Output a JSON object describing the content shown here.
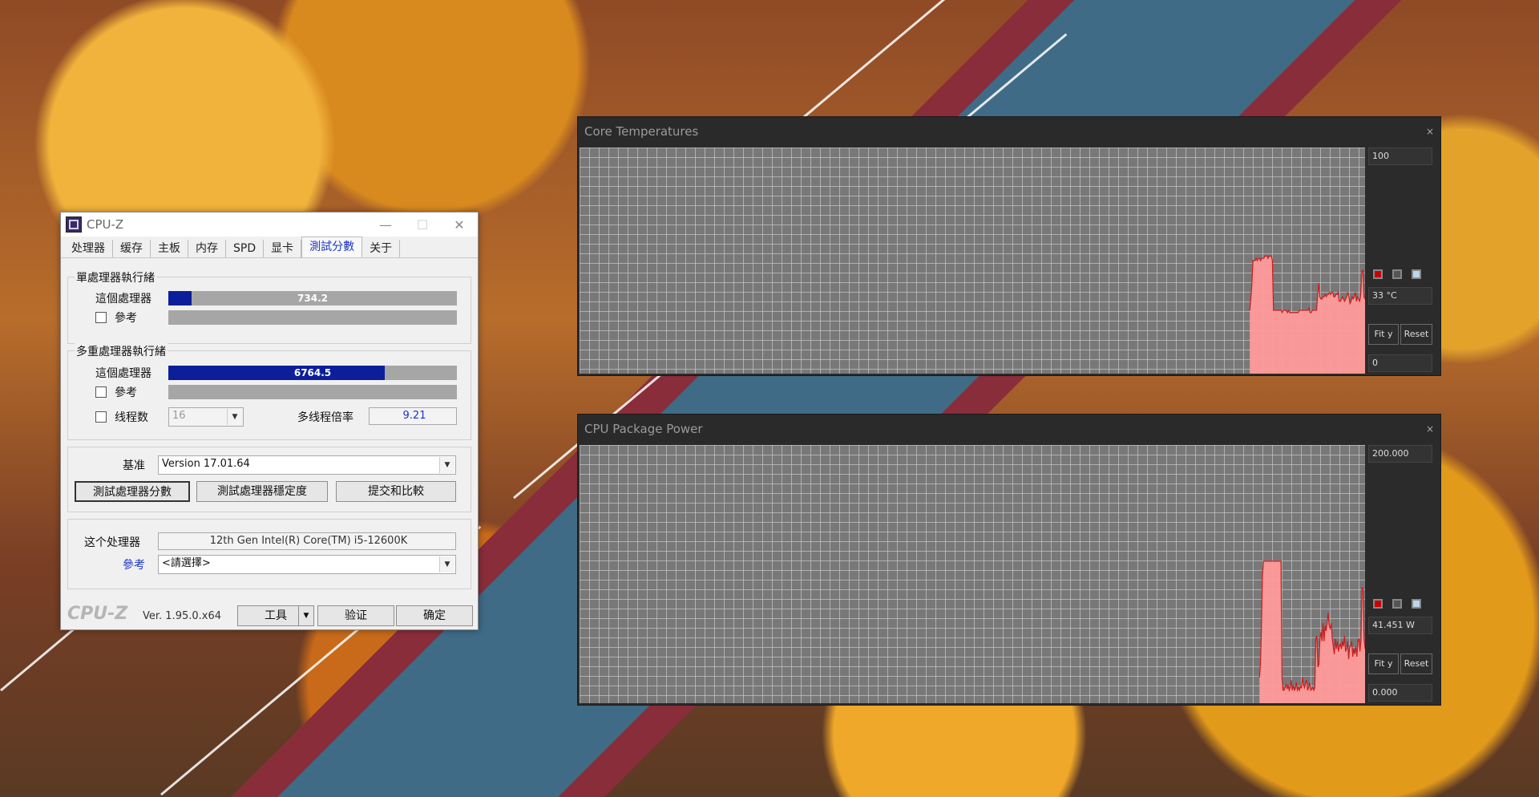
{
  "cpuz": {
    "title": "CPU-Z",
    "tabs": [
      "处理器",
      "缓存",
      "主板",
      "内存",
      "SPD",
      "显卡",
      "測試分數",
      "关于"
    ],
    "active_tab": "測試分數",
    "single": {
      "group_label": "單處理器執行緒",
      "this_label": "這個處理器",
      "this_score": "734.2",
      "this_fraction": 0.08,
      "ref_label": "參考"
    },
    "multi": {
      "group_label": "多重處理器執行緒",
      "this_label": "這個處理器",
      "this_score": "6764.5",
      "this_fraction": 0.75,
      "ref_label": "參考",
      "threads_label": "线程数",
      "threads_value": "16",
      "ratio_label": "多线程倍率",
      "ratio_value": "9.21"
    },
    "bench": {
      "label": "基准",
      "version": "Version 17.01.64",
      "btn_score": "測試處理器分數",
      "btn_stress": "測試處理器穩定度",
      "btn_submit": "提交和比較"
    },
    "proc": {
      "label": "这个处理器",
      "value": "12th Gen Intel(R) Core(TM) i5-12600K",
      "ref_label": "參考",
      "ref_select": "<請選擇>"
    },
    "footer": {
      "logo": "CPU-Z",
      "version": "Ver. 1.95.0.x64",
      "tools": "工具",
      "validate": "验证",
      "ok": "确定"
    }
  },
  "temp_monitor": {
    "title": "Core Temperatures",
    "close": "×",
    "max": "100",
    "current": "33 °C",
    "min": "0",
    "fit": "Fit y",
    "reset": "Reset",
    "colors": {
      "line": "#c81e1e",
      "fill": "#ff9a9a"
    },
    "chart_data": {
      "type": "area",
      "ylim": [
        0,
        100
      ],
      "values": [
        0,
        0,
        0,
        0,
        0,
        0,
        0,
        0,
        0,
        0,
        0,
        0,
        0,
        0,
        0,
        0,
        0,
        0,
        0,
        0,
        0,
        0,
        0,
        0,
        0,
        0,
        0,
        0,
        0,
        0,
        0,
        0,
        0,
        0,
        0,
        0,
        0,
        0,
        0,
        0,
        0,
        0,
        0,
        0,
        0,
        0,
        0,
        0,
        0,
        0,
        0,
        0,
        0,
        0,
        0,
        0,
        0,
        0,
        0,
        0,
        0,
        0,
        0,
        0,
        0,
        0,
        0,
        0,
        0,
        0,
        0,
        0,
        0,
        0,
        0,
        0,
        0,
        0,
        0,
        0,
        0,
        0,
        0,
        0,
        0,
        0,
        0,
        0,
        0,
        0,
        0,
        0,
        0,
        0,
        0,
        0,
        0,
        0,
        0,
        0,
        0,
        0,
        0,
        0,
        0,
        0,
        0,
        0,
        0,
        0,
        0,
        0,
        0,
        0,
        0,
        0,
        0,
        0,
        0,
        0,
        0,
        0,
        0,
        0,
        0,
        0,
        0,
        0,
        0,
        0,
        0,
        0,
        0,
        0,
        0,
        0,
        0,
        0,
        0,
        0,
        0,
        0,
        0,
        0,
        0,
        0,
        0,
        0,
        0,
        0,
        0,
        0,
        0,
        0,
        0,
        0,
        0,
        0,
        0,
        0,
        0,
        0,
        0,
        0,
        0,
        0,
        0,
        0,
        0,
        0,
        0,
        0,
        0,
        0,
        0,
        0,
        0,
        0,
        0,
        0,
        0,
        0,
        0,
        0,
        0,
        0,
        0,
        0,
        0,
        0,
        0,
        0,
        0,
        0,
        0,
        0,
        0,
        0,
        0,
        0,
        0,
        0,
        0,
        0,
        0,
        0,
        0,
        0,
        0,
        0,
        0,
        0,
        0,
        0,
        0,
        0,
        0,
        0,
        0,
        0,
        0,
        0,
        0,
        0,
        0,
        0,
        0,
        0,
        0,
        0,
        0,
        0,
        0,
        0,
        0,
        0,
        0,
        0,
        0,
        0,
        0,
        0,
        0,
        0,
        0,
        0,
        0,
        0,
        0,
        0,
        0,
        0,
        0,
        0,
        0,
        0,
        0,
        0,
        0,
        0,
        0,
        0,
        0,
        0,
        0,
        0,
        0,
        0,
        0,
        0,
        0,
        0,
        0,
        0,
        0,
        0,
        0,
        0,
        0,
        0,
        0,
        0,
        0,
        0,
        0,
        0,
        0,
        0,
        0,
        0,
        0,
        0,
        0,
        0,
        0,
        0,
        0,
        0,
        0,
        0,
        0,
        0,
        0,
        0,
        0,
        0,
        0,
        0,
        0,
        0,
        0,
        0,
        0,
        0,
        0,
        0,
        0,
        0,
        0,
        0,
        0,
        0,
        0,
        0,
        0,
        0,
        0,
        0,
        0,
        0,
        0,
        0,
        0,
        0,
        0,
        0,
        0,
        0,
        0,
        0,
        0,
        0,
        0,
        0,
        0,
        0,
        0,
        0,
        0,
        0,
        0,
        0,
        0,
        0,
        0,
        0,
        0,
        0,
        0,
        0,
        0,
        0,
        0,
        0,
        0,
        0,
        0,
        0,
        0,
        0,
        0,
        0,
        0,
        0,
        0,
        0,
        0,
        0,
        0,
        0,
        0,
        0,
        0,
        0,
        0,
        0,
        0,
        0,
        0,
        0,
        0,
        0,
        0,
        0,
        0,
        0,
        0,
        0,
        0,
        0,
        0,
        0,
        0,
        0,
        0,
        0,
        0,
        0,
        0,
        0,
        0,
        0,
        0,
        0,
        0,
        0,
        0,
        0,
        0,
        0,
        0,
        0,
        0,
        0,
        0,
        0,
        0,
        0,
        0,
        0,
        0,
        0,
        0,
        0,
        0,
        0,
        0,
        0,
        0,
        0,
        0,
        0,
        0,
        0,
        0,
        0,
        0,
        0,
        0,
        0,
        0,
        0,
        0,
        0,
        0,
        0,
        0,
        0,
        0,
        0,
        0,
        0,
        0,
        0,
        0,
        0,
        0,
        0,
        0,
        0,
        0,
        0,
        0,
        0,
        0,
        0,
        0,
        0,
        0,
        0,
        0,
        0,
        0,
        0,
        0,
        0,
        0,
        0,
        0,
        0,
        0,
        0,
        0,
        0,
        0,
        0,
        0,
        0,
        0,
        0,
        0,
        0,
        0,
        0,
        0,
        0,
        0,
        0,
        0,
        0,
        0,
        0,
        0,
        0,
        0,
        0,
        0,
        0,
        0,
        0,
        0,
        0,
        0,
        0,
        0,
        0,
        0,
        0,
        0,
        0,
        0,
        0,
        0,
        0,
        0,
        0,
        0,
        0,
        0,
        0,
        0,
        0,
        0,
        0,
        0,
        0,
        0,
        0,
        0,
        0,
        0,
        0,
        0,
        0,
        0,
        0,
        0,
        0,
        0,
        0,
        0,
        0,
        0,
        0,
        0,
        0,
        0,
        0,
        0,
        0,
        0,
        0,
        0,
        0,
        0,
        0,
        0,
        0,
        0,
        0,
        0,
        0,
        0,
        0,
        0,
        0,
        0,
        0,
        0,
        0,
        0,
        0,
        0,
        0,
        0,
        0,
        0,
        0,
        0,
        0,
        0,
        0,
        0,
        0,
        0,
        0,
        0,
        0,
        0,
        0,
        0,
        0,
        0,
        0,
        0,
        0,
        0,
        0,
        0,
        0,
        0,
        0,
        28,
        33,
        40,
        50,
        50,
        50,
        51,
        50,
        51,
        51,
        50,
        51,
        51,
        51,
        52,
        52,
        52,
        51,
        52,
        52,
        52,
        50,
        28,
        28,
        28,
        28,
        28,
        28,
        28,
        28,
        27,
        28,
        28,
        28,
        28,
        27,
        28,
        27,
        27,
        27,
        27,
        27,
        27,
        27,
        27,
        27,
        28,
        28,
        28,
        28,
        28,
        28,
        28,
        28,
        28,
        29,
        27,
        27,
        28,
        28,
        28,
        28,
        28,
        35,
        40,
        34,
        33,
        33,
        34,
        34,
        35,
        34,
        35,
        35,
        36,
        35,
        36,
        36,
        34,
        34,
        35,
        35,
        36,
        32,
        32,
        33,
        34,
        33,
        32,
        33,
        34,
        36,
        34,
        31,
        32,
        34,
        33,
        34,
        36,
        32,
        34,
        33,
        32,
        35,
        45,
        46,
        34,
        33
      ]
    }
  },
  "power_monitor": {
    "title": "CPU Package Power",
    "close": "×",
    "max": "200.000",
    "current": "41.451 W",
    "min": "0.000",
    "fit": "Fit y",
    "reset": "Reset",
    "colors": {
      "line": "#c81e1e",
      "fill": "#ff9a9a"
    },
    "chart_data": {
      "type": "area",
      "ylim": [
        0,
        200
      ],
      "values": [
        0,
        0,
        0,
        0,
        0,
        0,
        0,
        0,
        0,
        0,
        0,
        0,
        0,
        0,
        0,
        0,
        0,
        0,
        0,
        0,
        0,
        0,
        0,
        0,
        0,
        0,
        0,
        0,
        0,
        0,
        0,
        0,
        0,
        0,
        0,
        0,
        0,
        0,
        0,
        0,
        0,
        0,
        0,
        0,
        0,
        0,
        0,
        0,
        0,
        0,
        0,
        0,
        0,
        0,
        0,
        0,
        0,
        0,
        0,
        0,
        0,
        0,
        0,
        0,
        0,
        0,
        0,
        0,
        0,
        0,
        0,
        0,
        0,
        0,
        0,
        0,
        0,
        0,
        0,
        0,
        0,
        0,
        0,
        0,
        0,
        0,
        0,
        0,
        0,
        0,
        0,
        0,
        0,
        0,
        0,
        0,
        0,
        0,
        0,
        0,
        0,
        0,
        0,
        0,
        0,
        0,
        0,
        0,
        0,
        0,
        0,
        0,
        0,
        0,
        0,
        0,
        0,
        0,
        0,
        0,
        0,
        0,
        0,
        0,
        0,
        0,
        0,
        0,
        0,
        0,
        0,
        0,
        0,
        0,
        0,
        0,
        0,
        0,
        0,
        0,
        0,
        0,
        0,
        0,
        0,
        0,
        0,
        0,
        0,
        0,
        0,
        0,
        0,
        0,
        0,
        0,
        0,
        0,
        0,
        0,
        0,
        0,
        0,
        0,
        0,
        0,
        0,
        0,
        0,
        0,
        0,
        0,
        0,
        0,
        0,
        0,
        0,
        0,
        0,
        0,
        0,
        0,
        0,
        0,
        0,
        0,
        0,
        0,
        0,
        0,
        0,
        0,
        0,
        0,
        0,
        0,
        0,
        0,
        0,
        0,
        0,
        0,
        0,
        0,
        0,
        0,
        0,
        0,
        0,
        0,
        0,
        0,
        0,
        0,
        0,
        0,
        0,
        0,
        0,
        0,
        0,
        0,
        0,
        0,
        0,
        0,
        0,
        0,
        0,
        0,
        0,
        0,
        0,
        0,
        0,
        0,
        0,
        0,
        0,
        0,
        0,
        0,
        0,
        0,
        0,
        0,
        0,
        0,
        0,
        0,
        0,
        0,
        0,
        0,
        0,
        0,
        0,
        0,
        0,
        0,
        0,
        0,
        0,
        0,
        0,
        0,
        0,
        0,
        0,
        0,
        0,
        0,
        0,
        0,
        0,
        0,
        0,
        0,
        0,
        0,
        0,
        0,
        0,
        0,
        0,
        0,
        0,
        0,
        0,
        0,
        0,
        0,
        0,
        0,
        0,
        0,
        0,
        0,
        0,
        0,
        0,
        0,
        0,
        0,
        0,
        0,
        0,
        0,
        0,
        0,
        0,
        0,
        0,
        0,
        0,
        0,
        0,
        0,
        0,
        0,
        0,
        0,
        0,
        0,
        0,
        0,
        0,
        0,
        0,
        0,
        0,
        0,
        0,
        0,
        0,
        0,
        0,
        0,
        0,
        0,
        0,
        0,
        0,
        0,
        0,
        0,
        0,
        0,
        0,
        0,
        0,
        0,
        0,
        0,
        0,
        0,
        0,
        0,
        0,
        0,
        0,
        0,
        0,
        0,
        0,
        0,
        0,
        0,
        0,
        0,
        0,
        0,
        0,
        0,
        0,
        0,
        0,
        0,
        0,
        0,
        0,
        0,
        0,
        0,
        0,
        0,
        0,
        0,
        0,
        0,
        0,
        0,
        0,
        0,
        0,
        0,
        0,
        0,
        0,
        0,
        0,
        0,
        0,
        0,
        0,
        0,
        0,
        0,
        0,
        0,
        0,
        0,
        0,
        0,
        0,
        0,
        0,
        0,
        0,
        0,
        0,
        0,
        0,
        0,
        0,
        0,
        0,
        0,
        0,
        0,
        0,
        0,
        0,
        0,
        0,
        0,
        0,
        0,
        0,
        0,
        0,
        0,
        0,
        0,
        0,
        0,
        0,
        0,
        0,
        0,
        0,
        0,
        0,
        0,
        0,
        0,
        0,
        0,
        0,
        0,
        0,
        0,
        0,
        0,
        0,
        0,
        0,
        0,
        0,
        0,
        0,
        0,
        0,
        0,
        0,
        0,
        0,
        0,
        0,
        0,
        0,
        0,
        0,
        0,
        0,
        0,
        0,
        0,
        0,
        0,
        0,
        0,
        0,
        0,
        0,
        0,
        0,
        0,
        0,
        0,
        0,
        0,
        0,
        0,
        0,
        0,
        0,
        0,
        0,
        0,
        0,
        0,
        0,
        0,
        0,
        0,
        0,
        0,
        0,
        0,
        0,
        0,
        0,
        0,
        0,
        0,
        0,
        0,
        0,
        0,
        0,
        0,
        0,
        0,
        0,
        0,
        0,
        0,
        0,
        0,
        0,
        0,
        0,
        0,
        0,
        0,
        0,
        0,
        0,
        0,
        0,
        0,
        0,
        0,
        0,
        0,
        0,
        0,
        0,
        0,
        0,
        0,
        0,
        0,
        0,
        0,
        0,
        0,
        0,
        0,
        0,
        0,
        0,
        0,
        0,
        0,
        0,
        0,
        0,
        0,
        0,
        0,
        0,
        0,
        0,
        0,
        0,
        0,
        0,
        0,
        0,
        0,
        0,
        0,
        0,
        0,
        0,
        0,
        0,
        0,
        0,
        0,
        0,
        0,
        0,
        0,
        0,
        0,
        0,
        0,
        0,
        0,
        0,
        0,
        0,
        0,
        0,
        0,
        0,
        0,
        0,
        0,
        0,
        0,
        0,
        0,
        0,
        0,
        0,
        0,
        0,
        0,
        0,
        0,
        0,
        0,
        0,
        0,
        0,
        0,
        0,
        0,
        0,
        0,
        0,
        0,
        0,
        0,
        0,
        0,
        0,
        0,
        0,
        0,
        0,
        0,
        0,
        0,
        0,
        0,
        0,
        0,
        0,
        20,
        30,
        60,
        100,
        110,
        110,
        110,
        110,
        110,
        110,
        110,
        110,
        110,
        110,
        110,
        110,
        110,
        110,
        110,
        110,
        110,
        110,
        20,
        10,
        10,
        12,
        15,
        11,
        14,
        10,
        12,
        18,
        10,
        14,
        10,
        11,
        16,
        10,
        12,
        10,
        13,
        12,
        20,
        14,
        12,
        16,
        18,
        10,
        12,
        16,
        10,
        11,
        12,
        10,
        12,
        50,
        52,
        28,
        30,
        50,
        55,
        48,
        62,
        48,
        60,
        56,
        62,
        70,
        60,
        58,
        62,
        50,
        44,
        38,
        50,
        42,
        48,
        40,
        44,
        46,
        42,
        48,
        44,
        52,
        40,
        42,
        48,
        34,
        44,
        44,
        48,
        36,
        42,
        38,
        44,
        36,
        48,
        50,
        40,
        48,
        90,
        88,
        50,
        42
      ]
    }
  }
}
